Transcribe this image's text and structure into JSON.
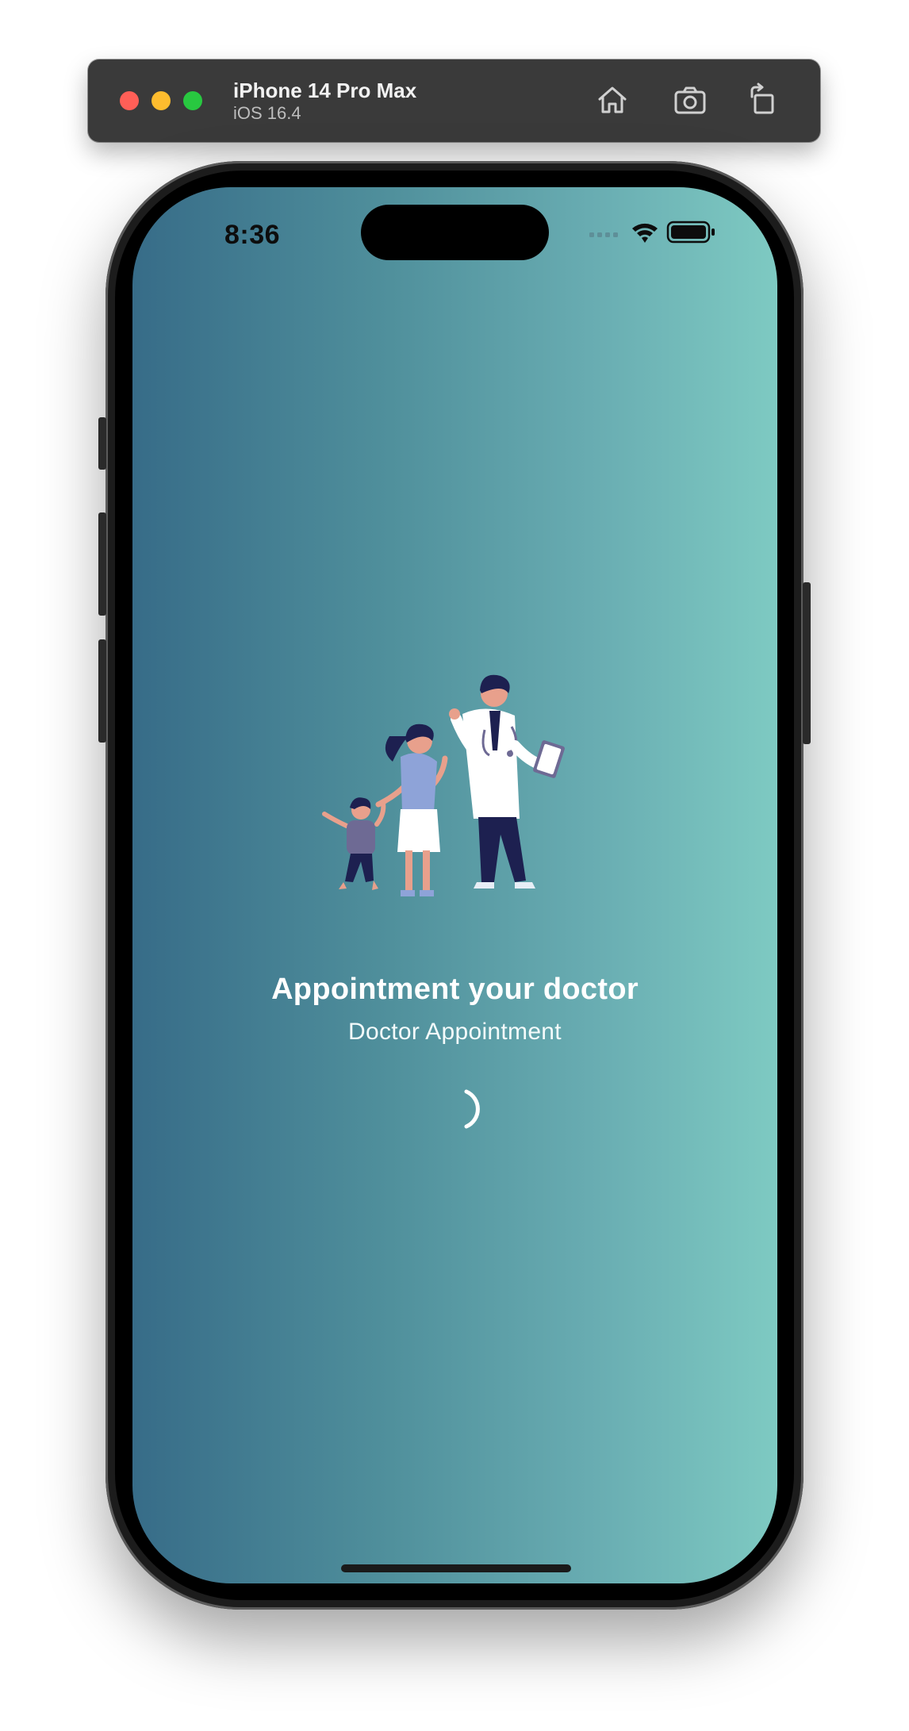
{
  "simulator": {
    "device_name": "iPhone 14 Pro Max",
    "os_version": "iOS 16.4",
    "controls": {
      "close": "close-window",
      "minimize": "minimize-window",
      "zoom": "zoom-window",
      "home": "home-icon",
      "screenshot": "camera-icon",
      "rotate": "rotate-icon"
    }
  },
  "status_bar": {
    "time": "8:36",
    "icons": [
      "cellular-signal-icon",
      "wifi-icon",
      "battery-icon"
    ]
  },
  "splash": {
    "illustration": "family-with-doctor-illustration",
    "title": "Appointment your doctor",
    "subtitle": "Doctor Appointment",
    "loading_indicator": "spinner-icon"
  },
  "colors": {
    "gradient_start": "#376c88",
    "gradient_end": "#7ecac2",
    "text": "#ffffff",
    "toolbar": "#3a3a3a"
  }
}
